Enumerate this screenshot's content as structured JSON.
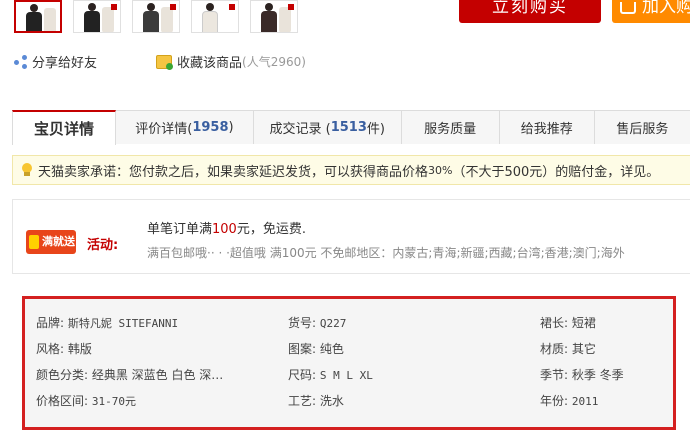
{
  "buy": {
    "buy_label": "立刻购买",
    "cart_label": "加入购"
  },
  "share": {
    "label": "分享给好友"
  },
  "favorite": {
    "label": "收藏该商品",
    "count": "(人气2960)"
  },
  "tabs": [
    {
      "label": "宝贝详情",
      "count": ""
    },
    {
      "label": "评价详情(",
      "count": "1958",
      "tail": ")"
    },
    {
      "label": "成交记录 (",
      "count": "1513",
      "tail": "件)"
    },
    {
      "label": "服务质量",
      "count": ""
    },
    {
      "label": "给我推荐",
      "count": ""
    },
    {
      "label": "售后服务",
      "count": ""
    }
  ],
  "promise": {
    "prefix": "天猫卖家承诺：您付款之后，如果卖家延迟发货，可以获得商品价格",
    "pct": "30%",
    "suffix": "（不大于500元）的赔付金，详见。"
  },
  "activity": {
    "badge": "满就送",
    "label": "活动:",
    "line1_prefix": "单笔订单满",
    "line1_amount": "100",
    "line1_suffix": "元，免运费.",
    "line2": "满百包邮哦·· · ·超值哦 满100元 不免邮地区：内蒙古;青海;新疆;西藏;台湾;香港;澳门;海外"
  },
  "attributes": {
    "brand": {
      "label": "品牌: ",
      "value": "斯特凡妮 SITEFANNI"
    },
    "style": {
      "label": "风格: ",
      "value": "韩版"
    },
    "color": {
      "label": "颜色分类: ",
      "value": "经典黑 深蓝色 白色 深…"
    },
    "price_range": {
      "label": "价格区间: ",
      "value": "31-70元"
    },
    "item_no": {
      "label": "货号: ",
      "value": "Q227"
    },
    "pattern": {
      "label": "图案: ",
      "value": "纯色"
    },
    "size": {
      "label": "尺码: ",
      "value": "S M L XL"
    },
    "craft": {
      "label": "工艺: ",
      "value": "洗水"
    },
    "skirt_length": {
      "label": "裙长: ",
      "value": "短裙"
    },
    "material": {
      "label": "材质: ",
      "value": "其它"
    },
    "season": {
      "label": "季节: ",
      "value": "秋季 冬季"
    },
    "year": {
      "label": "年份: ",
      "value": "2011"
    }
  }
}
